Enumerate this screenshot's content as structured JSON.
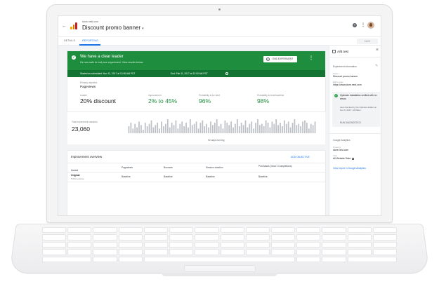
{
  "header": {
    "breadcrumb": "store.nest.com",
    "title": "Discount promo banner",
    "back_icon": "arrow-left-icon",
    "help_icon": "help-icon",
    "more_icon": "more-vert-icon"
  },
  "tabs": [
    {
      "label": "DETAILS",
      "active": false
    },
    {
      "label": "REPORTING",
      "active": true
    }
  ],
  "save_label": "SAVE",
  "banner": {
    "title": "We have a clear leader",
    "subtitle": "It's now safe to end your experiment. View results below.",
    "end_button": "END EXPERIMENT",
    "started": "Started as scheduled: Nov 12, 2017 at 12:00 AM PST",
    "ended": "End: Feb 11, 2017 at 12:00 AM PST",
    "color": "#1e8e3e"
  },
  "objective": {
    "label": "Primary objective",
    "value": "Pageviews"
  },
  "metrics": {
    "leader_label": "Leader",
    "leader_value": "20% discount",
    "improvement_label": "Improvement",
    "improvement_value": "2% to 45%",
    "best_label": "Probability to be best",
    "best_value": "96%",
    "beat_label": "Probability to beat baseline",
    "beat_value": "98%"
  },
  "sessions": {
    "label": "Total experiment sessions",
    "value": "23,060",
    "running": "92 days running"
  },
  "chart_data": {
    "type": "bar",
    "values": [
      6,
      9,
      4,
      8,
      5,
      10,
      7,
      3,
      9,
      6,
      8,
      11,
      5,
      7,
      9,
      4,
      10,
      6,
      8,
      12,
      5,
      9,
      7,
      11,
      4,
      8,
      10,
      6,
      9,
      5,
      12,
      7,
      8,
      10,
      4,
      9,
      11,
      6,
      8,
      5,
      10,
      7,
      9,
      12,
      6,
      8,
      4,
      11,
      9,
      7,
      10,
      5,
      8,
      12,
      6,
      9,
      7,
      11,
      5,
      8,
      10,
      4,
      9,
      12,
      7,
      8,
      6,
      11,
      9,
      5,
      10,
      8,
      12,
      7,
      9,
      6,
      11,
      8,
      10,
      5,
      9,
      12,
      7,
      8,
      6,
      10,
      11,
      9,
      4,
      8,
      7,
      10
    ],
    "xlabel": "",
    "ylabel": ""
  },
  "overview": {
    "title": "Improvement overview",
    "add_label": "ADD OBJECTIVE",
    "columns": [
      "Variant",
      "Pageviews",
      "Bounces",
      "Session duration",
      "Purchases (Goal 1 Completions)"
    ],
    "rows": [
      {
        "variant": "Original",
        "sessions": "5,610 sessions",
        "cells": [
          "Baseline",
          "Baseline",
          "Baseline",
          "Baseline"
        ]
      }
    ]
  },
  "panel": {
    "title": "A/B test",
    "section": "Experiment information",
    "name_label": "Name",
    "name_value": "Discount promo banner",
    "page_label": "Editor page",
    "page_value": "https://www.store.nest.com",
    "verify_title": "Optimize installation verified with no errors",
    "verify_sub": "Last checked by the Optimize Editor on Nov 6, 2017, 10:03am",
    "diag_button": "RUN DIAGNOSTICS",
    "ga_section": "Google Analytics",
    "property_label": "Property",
    "property_value": "store.nest.com",
    "view_label": "View",
    "view_value": "All Website Data",
    "ga_link": "View report in Google Analytics"
  }
}
